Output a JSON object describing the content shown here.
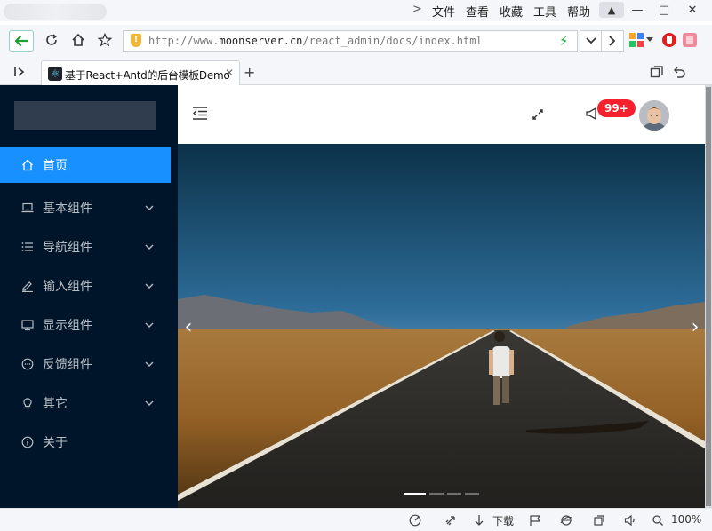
{
  "browser": {
    "menu": [
      "文件",
      "查看",
      "收藏",
      "工具",
      "帮助"
    ],
    "url_prefix": "http://www.",
    "url_host": "moonserver.cn",
    "url_path": "/react_admin/docs/index.html",
    "tab_title": "基于React+Antd的后台模板Demo",
    "status_download": "下载",
    "zoom": "100%"
  },
  "sidebar": {
    "items": [
      {
        "label": "首页",
        "icon": "home-icon",
        "active": true,
        "submenu": false
      },
      {
        "label": "基本组件",
        "icon": "laptop-icon",
        "active": false,
        "submenu": true
      },
      {
        "label": "导航组件",
        "icon": "bars-icon",
        "active": false,
        "submenu": true
      },
      {
        "label": "输入组件",
        "icon": "edit-icon",
        "active": false,
        "submenu": true
      },
      {
        "label": "显示组件",
        "icon": "desktop-icon",
        "active": false,
        "submenu": true
      },
      {
        "label": "反馈组件",
        "icon": "message-icon",
        "active": false,
        "submenu": true
      },
      {
        "label": "其它",
        "icon": "bulb-icon",
        "active": false,
        "submenu": true
      },
      {
        "label": "关于",
        "icon": "info-icon",
        "active": false,
        "submenu": false
      }
    ]
  },
  "header": {
    "badge": "99+"
  },
  "carousel": {
    "prev": "‹",
    "next": "›",
    "slides": 4,
    "current": 1
  },
  "colors": {
    "sidebar_bg": "#001529",
    "accent": "#1890ff",
    "badge": "#f5222d"
  }
}
